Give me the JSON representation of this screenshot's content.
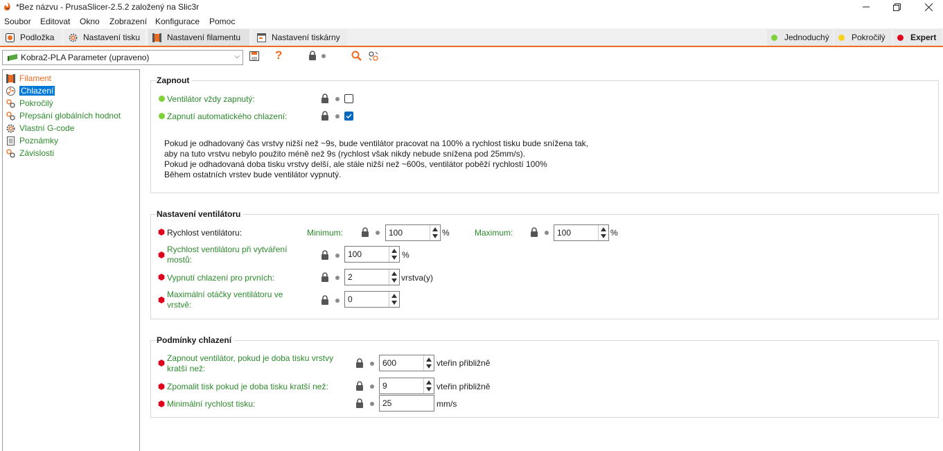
{
  "window": {
    "title": "*Bez názvu - PrusaSlicer-2.5.2 založený na Slic3r"
  },
  "menu": [
    "Soubor",
    "Editovat",
    "Okno",
    "Zobrazení",
    "Konfigurace",
    "Pomoc"
  ],
  "tabs": [
    "Podložka",
    "Nastavení tisku",
    "Nastavení filamentu",
    "Nastavení tiskárny"
  ],
  "active_tab": "Nastavení filamentu",
  "modes": [
    {
      "label": "Jednoduchý",
      "color": "#7fd13b"
    },
    {
      "label": "Pokročilý",
      "color": "#f8d21b"
    },
    {
      "label": "Expert",
      "color": "#e0001b"
    }
  ],
  "preset": {
    "name": "Kobra2-PLA Parameter (upraveno)"
  },
  "colors": {
    "accent": "#ed6b21",
    "simple": "#7fd13b",
    "expert": "#e0001b",
    "label_green": "#2c8a2c",
    "selection": "#0078d7"
  },
  "sidebar": {
    "items": [
      "Filament",
      "Chlazení",
      "Pokročilý",
      "Přepsání globálních hodnot",
      "Vlastní G-code",
      "Poznámky",
      "Závislosti"
    ],
    "selected": "Chlazení"
  },
  "groups": {
    "enable": {
      "title": "Zapnout",
      "fan_always_on": {
        "label": "Ventilátor vždy zapnutý:",
        "checked": false
      },
      "auto_cooling": {
        "label": "Zapnutí automatického chlazení:",
        "checked": true
      },
      "description": [
        "Pokud je odhadovaný čas vrstvy nižší než ~9s, bude ventilátor pracovat na 100% a rychlost tisku bude snížena tak,",
        "aby na tuto vrstvu nebylo použito méně než 9s (rychlost však nikdy nebude snížena pod 25mm/s).",
        "Pokud je odhadovaná doba tisku vrstvy delší, ale stále nižší než ~600s, ventilátor poběží rychlostí 100%",
        "Během ostatních vrstev bude ventilátor vypnutý."
      ]
    },
    "fan": {
      "title": "Nastavení ventilátoru",
      "fan_speed": {
        "label": "Rychlost ventilátoru:",
        "min_label": "Minimum:",
        "min_value": "100",
        "max_label": "Maximum:",
        "max_value": "100",
        "unit": "%"
      },
      "bridge_fan": {
        "label_line1": "Rychlost ventilátoru při vytváření",
        "label_line2": "mostů:",
        "value": "100",
        "unit": "%"
      },
      "disable_first": {
        "label": "Vypnutí chlazení pro prvních:",
        "value": "2",
        "unit": "vrstva(y)"
      },
      "max_fan_layer": {
        "label_line1": "Maximální otáčky ventilátoru ve",
        "label_line2": "vrstvě:",
        "value": "0"
      }
    },
    "conditions": {
      "title": "Podmínky chlazení",
      "fan_below": {
        "label_line1": "Zapnout ventilátor, pokud je doba tisku vrstvy",
        "label_line2": "kratší než:",
        "value": "600",
        "unit": "vteřin přibližně"
      },
      "slowdown_below": {
        "label": "Zpomalit tisk pokud je doba tisku kratší než:",
        "value": "9",
        "unit": "vteřin přibližně"
      },
      "min_speed": {
        "label": "Minimální rychlost tisku:",
        "value": "25",
        "unit": "mm/s"
      }
    }
  }
}
